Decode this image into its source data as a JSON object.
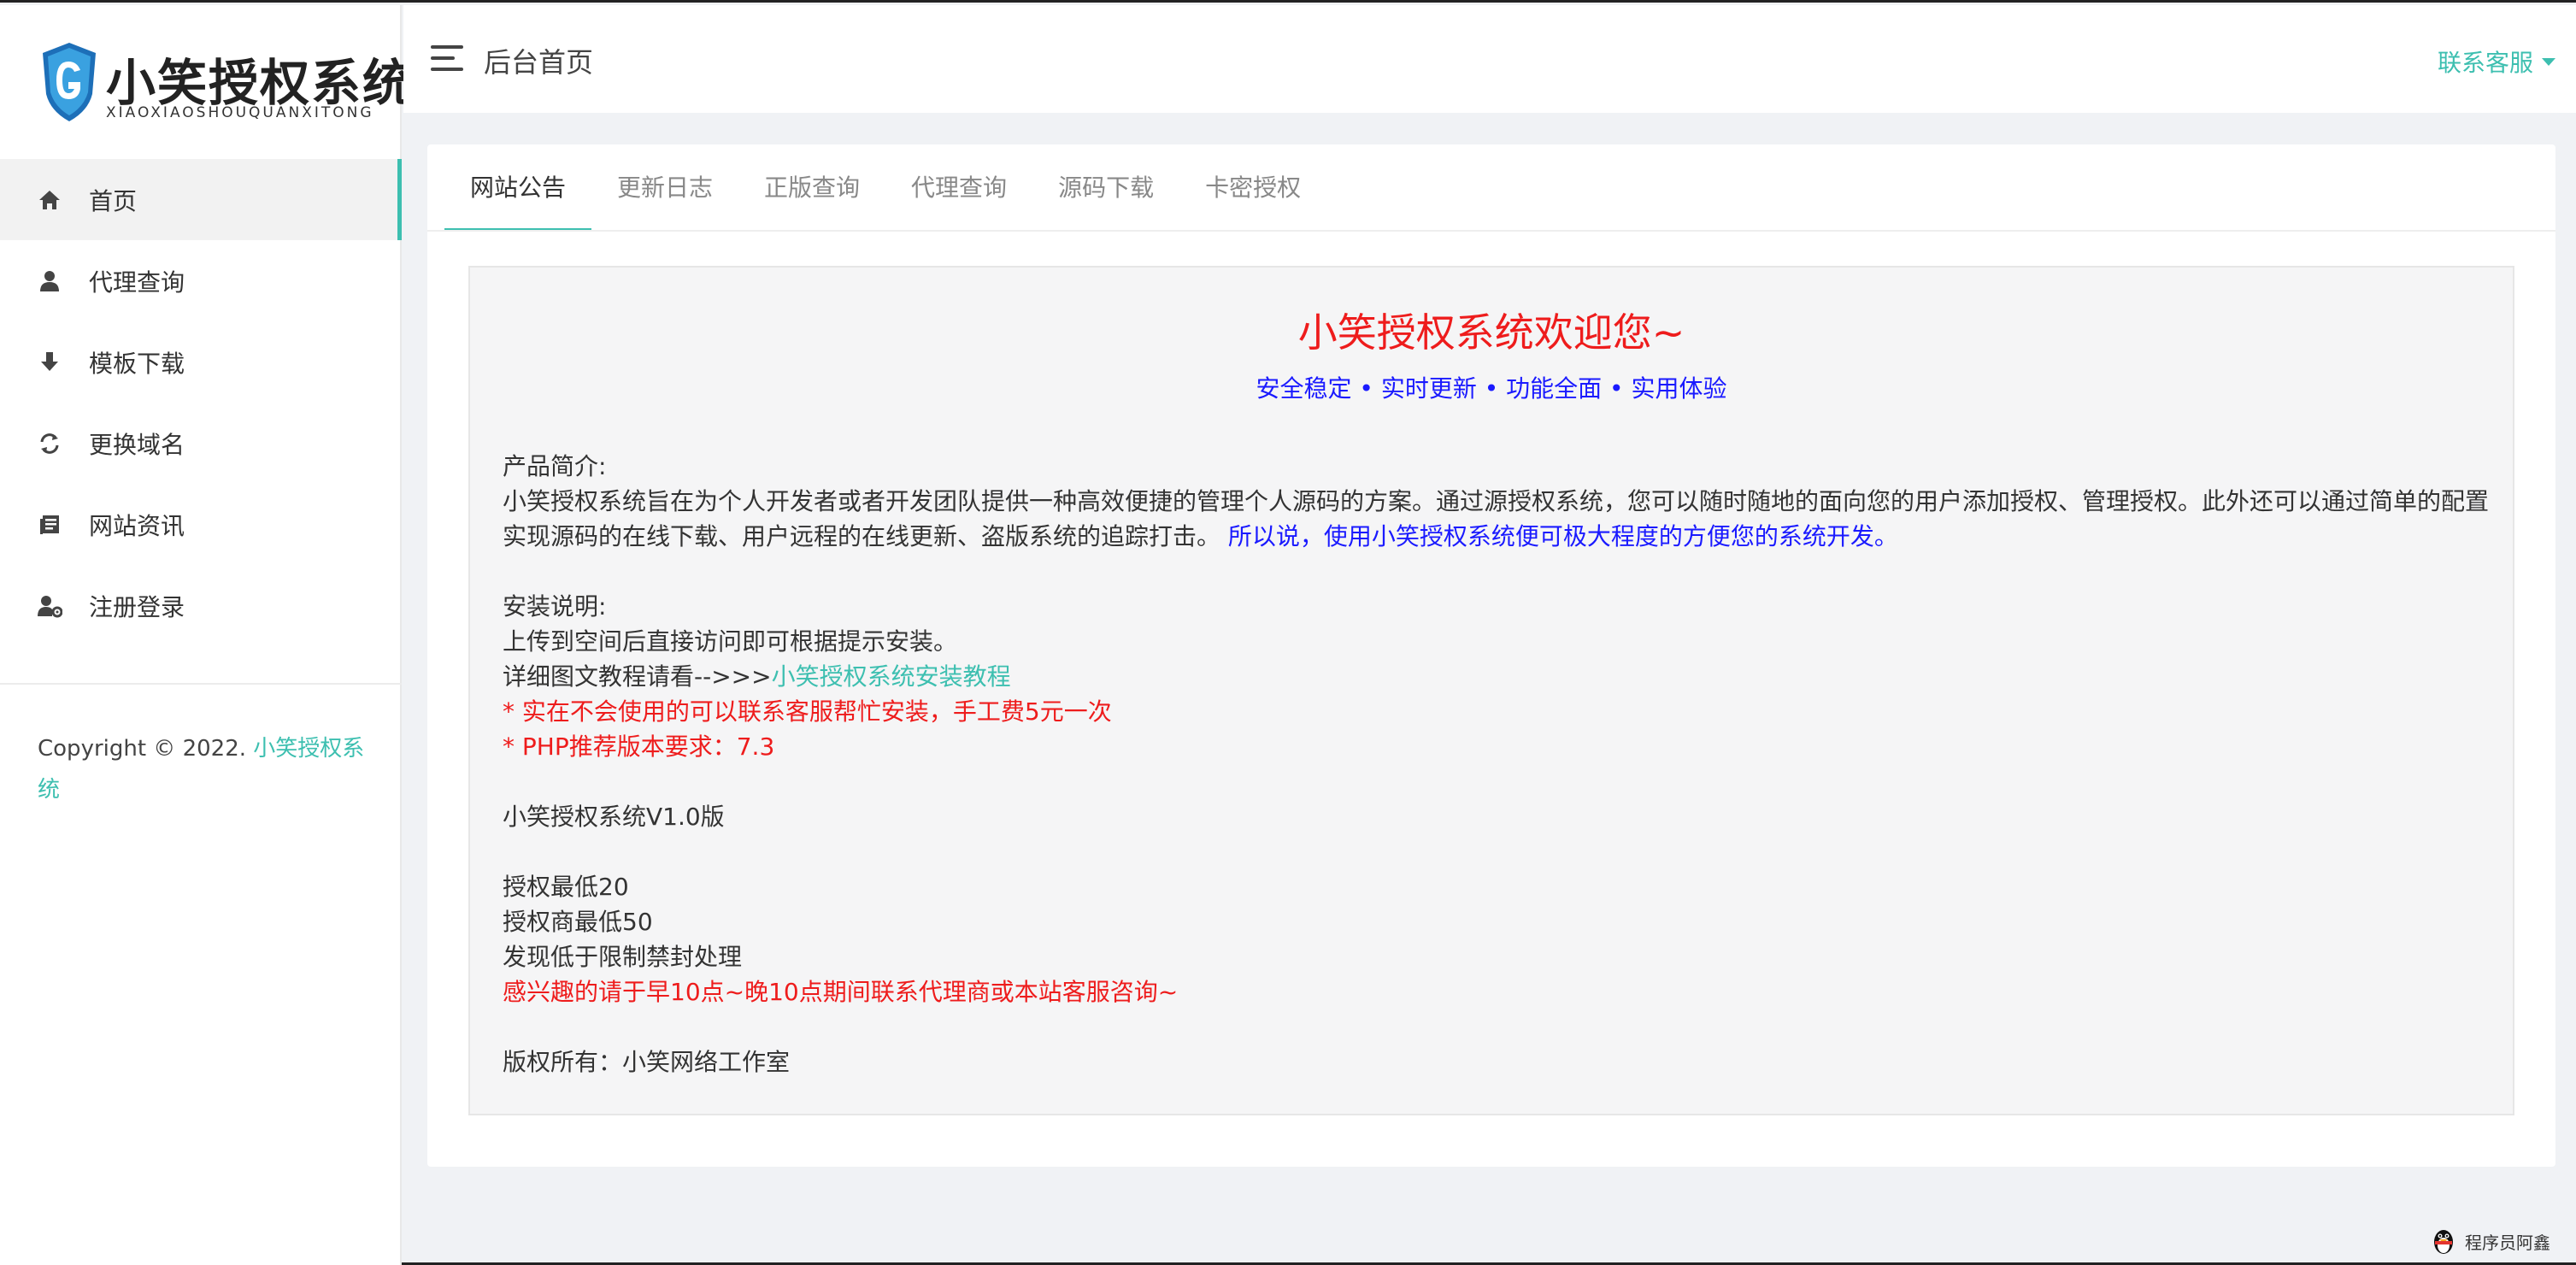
{
  "brand": {
    "title": "小笑授权系统",
    "subtitle": "XIAOXIAOSHOUQUANXITONG",
    "accent": "#3dbfb0"
  },
  "sidebar": {
    "items": [
      {
        "label": "首页",
        "icon": "home-icon",
        "active": true
      },
      {
        "label": "代理查询",
        "icon": "user-icon"
      },
      {
        "label": "模板下载",
        "icon": "download-icon"
      },
      {
        "label": "更换域名",
        "icon": "refresh-icon"
      },
      {
        "label": "网站资讯",
        "icon": "news-icon"
      },
      {
        "label": "注册登录",
        "icon": "user-settings-icon"
      }
    ],
    "copyright_prefix": "Copyright © 2022. ",
    "copyright_link": "小笑授权系统"
  },
  "header": {
    "title": "后台首页",
    "contact_label": "联系客服"
  },
  "tabs": [
    {
      "label": "网站公告",
      "active": true
    },
    {
      "label": "更新日志"
    },
    {
      "label": "正版查询"
    },
    {
      "label": "代理查询"
    },
    {
      "label": "源码下载"
    },
    {
      "label": "卡密授权"
    }
  ],
  "notice": {
    "title": "小笑授权系统欢迎您~",
    "tagline": "安全稳定 • 实时更新 • 功能全面 • 实用体验",
    "intro_heading": "产品简介:",
    "intro_text": "小笑授权系统旨在为个人开发者或者开发团队提供一种高效便捷的管理个人源码的方案。通过源授权系统，您可以随时随地的面向您的用户添加授权、管理授权。此外还可以通过简单的配置实现源码的在线下载、用户远程的在线更新、盗版系统的追踪打击。",
    "intro_highlight": "所以说，使用小笑授权系统便可极大程度的方便您的系统开发。",
    "install_heading": "安装说明:",
    "install_line1": "上传到空间后直接访问即可根据提示安装。",
    "install_line2_prefix": "详细图文教程请看-->>>",
    "install_line2_link": "小笑授权系统安装教程",
    "install_note1": "* 实在不会使用的可以联系客服帮忙安装，手工费5元一次",
    "install_note2": "* PHP推荐版本要求：7.3",
    "version": "小笑授权系统V1.0版",
    "price1": "授权最低20",
    "price2": "授权商最低50",
    "rule": "发现低于限制禁封处理",
    "contact_note": "感兴趣的请于早10点~晚10点期间联系代理商或本站客服咨询~",
    "owner": "版权所有：小笑网络工作室"
  },
  "watermark": {
    "text": "程序员阿鑫",
    "icon": "penguin-icon"
  }
}
